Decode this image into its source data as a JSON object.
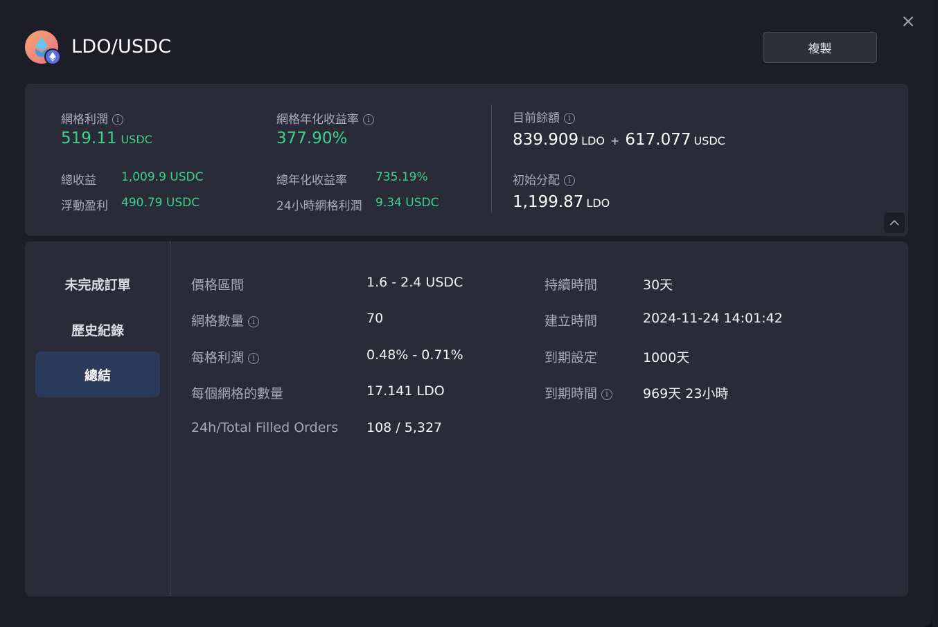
{
  "header": {
    "pair": "LDO/USDC",
    "copy_label": "複製",
    "close_icon": "close-icon"
  },
  "stats": {
    "grid_profit_label": "網格利潤",
    "grid_profit_value": "519.11",
    "grid_profit_unit": "USDC",
    "grid_apr_label": "網格年化收益率",
    "grid_apr_value": "377.90%",
    "total_profit_label": "總收益",
    "total_profit_value": "1,009.9 USDC",
    "floating_pnl_label": "浮動盈利",
    "floating_pnl_value": "490.79 USDC",
    "total_apr_label": "總年化收益率",
    "total_apr_value": "735.19%",
    "grid_profit_24h_label": "24小時網格利潤",
    "grid_profit_24h_value": "9.34 USDC",
    "balance_label": "目前餘額",
    "balance_ldo_value": "839.909",
    "balance_ldo_unit": "LDO",
    "balance_plus": "+",
    "balance_usdc_value": "617.077",
    "balance_usdc_unit": "USDC",
    "initial_label": "初始分配",
    "initial_value": "1,199.87",
    "initial_unit": "LDO"
  },
  "sidebar": {
    "items": [
      {
        "label": "未完成訂單",
        "active": false
      },
      {
        "label": "歷史紀錄",
        "active": false
      },
      {
        "label": "總結",
        "active": true
      }
    ]
  },
  "summary": {
    "left": [
      {
        "label": "價格區間",
        "value": "1.6 - 2.4 USDC",
        "info": false
      },
      {
        "label": "網格數量",
        "value": "70",
        "info": true
      },
      {
        "label": "每格利潤",
        "value": "0.48% - 0.71%",
        "info": true
      },
      {
        "label": "每個網格的數量",
        "value": "17.141 LDO",
        "info": false
      },
      {
        "label": "24h/Total Filled Orders",
        "value": "108 / 5,327",
        "info": false
      }
    ],
    "right": [
      {
        "label": "持續時間",
        "value": "30天",
        "info": false
      },
      {
        "label": "建立時間",
        "value": "2024-11-24 14:01:42",
        "info": false
      },
      {
        "label": "到期設定",
        "value": "1000天",
        "info": false
      },
      {
        "label": "到期時間",
        "value": "969天 23小時",
        "info": true
      }
    ]
  },
  "colors": {
    "accent_green": "#3fd18c",
    "active_tab": "#2b3a59",
    "panel": "#2a2b38",
    "background": "#1c1d26"
  }
}
